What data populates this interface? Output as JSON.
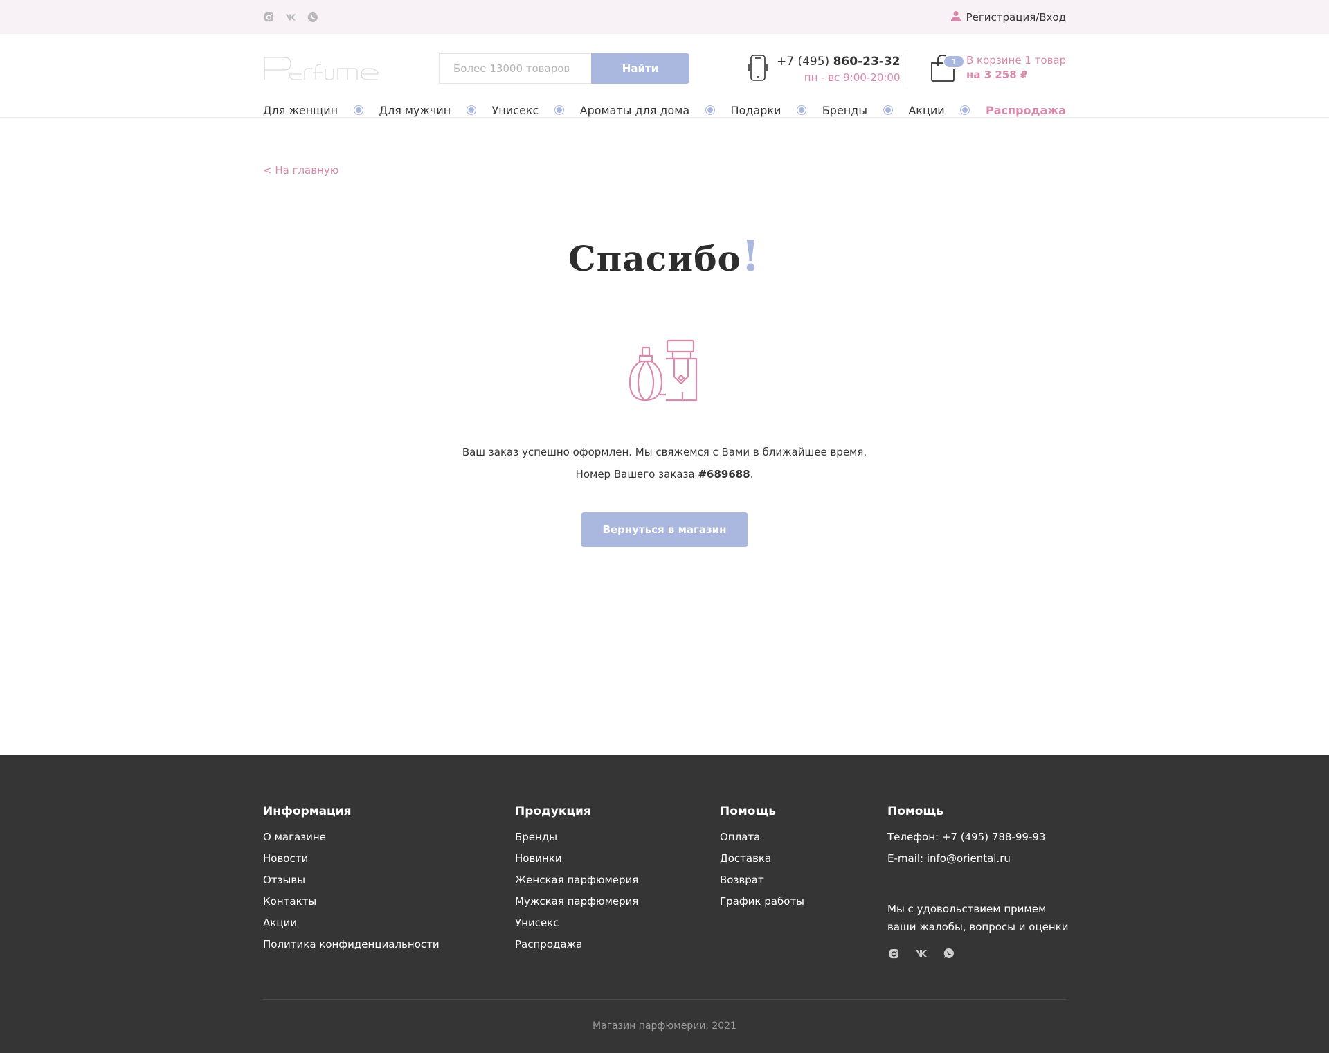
{
  "colors": {
    "accent_pink": "#d98aac",
    "accent_blue": "#aab8e0",
    "topbar_bg": "#f8f2f6",
    "footer_bg": "#353535"
  },
  "topbar": {
    "social_icons": [
      "instagram-icon",
      "vk-icon",
      "whatsapp-icon"
    ],
    "auth_label": "Регистрация/Вход"
  },
  "header": {
    "logo_text": "Perfume",
    "search": {
      "placeholder": "Более 13000 товаров",
      "value": "",
      "button_label": "Найти"
    },
    "phone": {
      "prefix": "+7 (495) ",
      "number": "860-23-32",
      "hours": "пн - вс 9:00-20:00"
    },
    "cart": {
      "count": "1",
      "line1": "В корзине 1 товар",
      "line2": "на 3 258 ₽"
    }
  },
  "nav": {
    "items": [
      "Для женщин",
      "Для мужчин",
      "Унисекс",
      "Ароматы для дома",
      "Подарки",
      "Бренды",
      "Акции",
      "Распродажа"
    ]
  },
  "main": {
    "back_link": "< На главную",
    "title": "Спасибо",
    "title_mark": "!",
    "message": "Ваш заказ успешно оформлен. Мы свяжемся с Вами в ближайшее время.",
    "order_prefix": "Номер Вашего заказа ",
    "order_number": "#689688",
    "order_suffix": ".",
    "return_button": "Вернуться в магазин"
  },
  "footer": {
    "info": {
      "title": "Информация",
      "links": [
        "О магазине",
        "Новости",
        "Отзывы",
        "Контакты",
        "Акции",
        "Политика конфиденциальности"
      ]
    },
    "products": {
      "title": "Продукция",
      "links": [
        "Бренды",
        "Новинки",
        "Женская парфюмерия",
        "Мужская парфюмерия",
        "Унисекс",
        "Распродажа"
      ]
    },
    "help": {
      "title": "Помощь",
      "links": [
        "Оплата",
        "Доставка",
        "Возврат",
        "График работы"
      ]
    },
    "contacts": {
      "title": "Помощь",
      "phone": "Телефон: +7 (495) 788-99-93",
      "email": "E-mail: info@oriental.ru",
      "text": "Мы с удовольствием примем ваши жалобы, вопросы и оценки",
      "social_icons": [
        "instagram-icon",
        "vk-icon",
        "whatsapp-icon"
      ]
    },
    "copyright": "Магазин парфюмерии, 2021"
  }
}
